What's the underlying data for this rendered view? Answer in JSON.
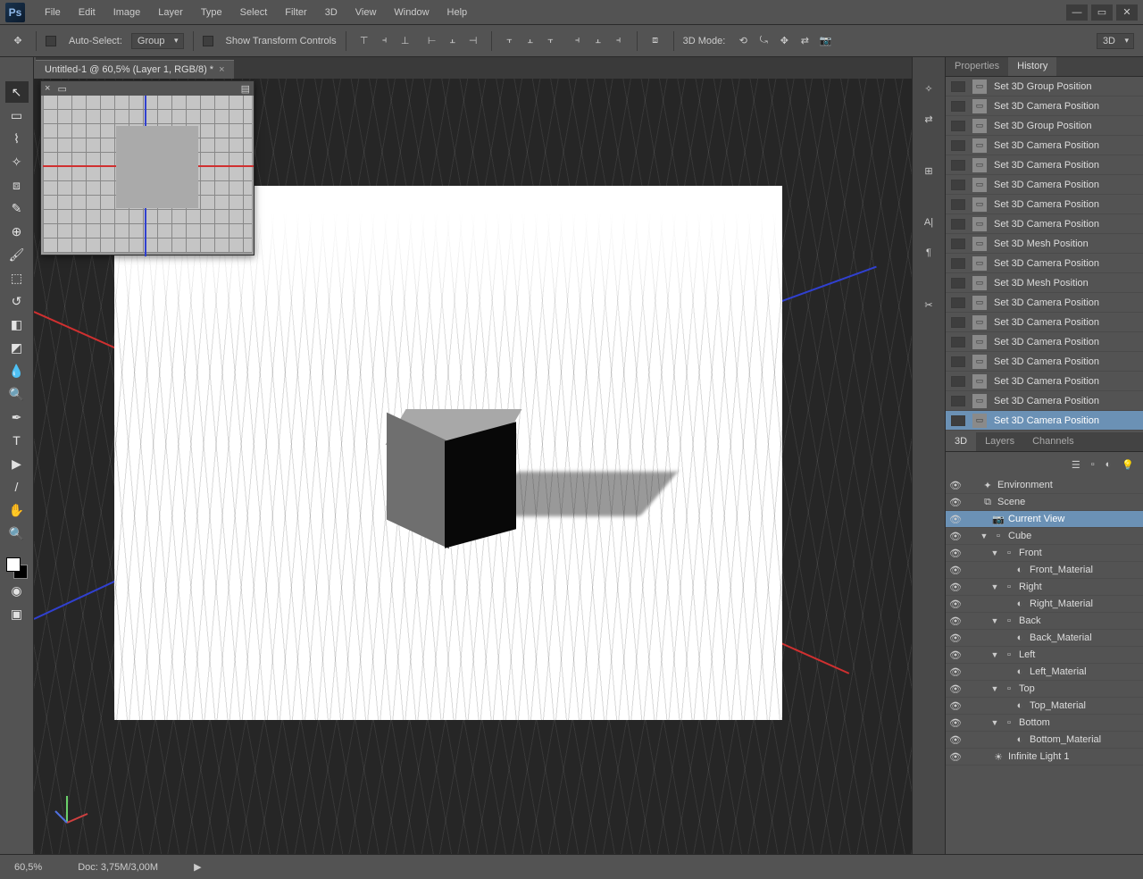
{
  "app": {
    "logo": "Ps"
  },
  "menu": [
    "File",
    "Edit",
    "Image",
    "Layer",
    "Type",
    "Select",
    "Filter",
    "3D",
    "View",
    "Window",
    "Help"
  ],
  "options": {
    "auto_select_label": "Auto-Select:",
    "group_label": "Group",
    "transform_label": "Show Transform Controls",
    "mode3d_label": "3D Mode:",
    "view_select": "3D"
  },
  "doc_tab": {
    "title": "Untitled-1 @ 60,5% (Layer 1, RGB/8) *"
  },
  "panels": {
    "top_tabs": [
      "Properties",
      "History"
    ],
    "active_top": 1,
    "bottom_tabs": [
      "3D",
      "Layers",
      "Channels"
    ],
    "active_bottom": 0
  },
  "history": [
    "Set 3D Group Position",
    "Set 3D Camera Position",
    "Set 3D Group Position",
    "Set 3D Camera Position",
    "Set 3D Camera Position",
    "Set 3D Camera Position",
    "Set 3D Camera Position",
    "Set 3D Camera Position",
    "Set 3D Mesh Position",
    "Set 3D Camera Position",
    "Set 3D Mesh Position",
    "Set 3D Camera Position",
    "Set 3D Camera Position",
    "Set 3D Camera Position",
    "Set 3D Camera Position",
    "Set 3D Camera Position",
    "Set 3D Camera Position",
    "Set 3D Camera Position"
  ],
  "history_selected": 17,
  "scene": [
    {
      "d": 0,
      "icon": "✦",
      "label": "Environment",
      "t": ""
    },
    {
      "d": 0,
      "icon": "⧉",
      "label": "Scene",
      "t": ""
    },
    {
      "d": 1,
      "icon": "■",
      "label": "Current View",
      "t": "",
      "sel": true,
      "cam": true
    },
    {
      "d": 1,
      "icon": "▫",
      "label": "Cube",
      "t": "▼"
    },
    {
      "d": 2,
      "icon": "▫",
      "label": "Front",
      "t": "▼"
    },
    {
      "d": 3,
      "icon": "◐",
      "label": "Front_Material",
      "t": ""
    },
    {
      "d": 2,
      "icon": "▫",
      "label": "Right",
      "t": "▼"
    },
    {
      "d": 3,
      "icon": "◐",
      "label": "Right_Material",
      "t": ""
    },
    {
      "d": 2,
      "icon": "▫",
      "label": "Back",
      "t": "▼"
    },
    {
      "d": 3,
      "icon": "◐",
      "label": "Back_Material",
      "t": ""
    },
    {
      "d": 2,
      "icon": "▫",
      "label": "Left",
      "t": "▼"
    },
    {
      "d": 3,
      "icon": "◐",
      "label": "Left_Material",
      "t": ""
    },
    {
      "d": 2,
      "icon": "▫",
      "label": "Top",
      "t": "▼"
    },
    {
      "d": 3,
      "icon": "◐",
      "label": "Top_Material",
      "t": ""
    },
    {
      "d": 2,
      "icon": "▫",
      "label": "Bottom",
      "t": "▼"
    },
    {
      "d": 3,
      "icon": "◐",
      "label": "Bottom_Material",
      "t": ""
    },
    {
      "d": 1,
      "icon": "☀",
      "label": "Infinite Light 1",
      "t": ""
    }
  ],
  "status": {
    "zoom": "60,5%",
    "doc_info": "Doc: 3,75M/3,00M"
  }
}
